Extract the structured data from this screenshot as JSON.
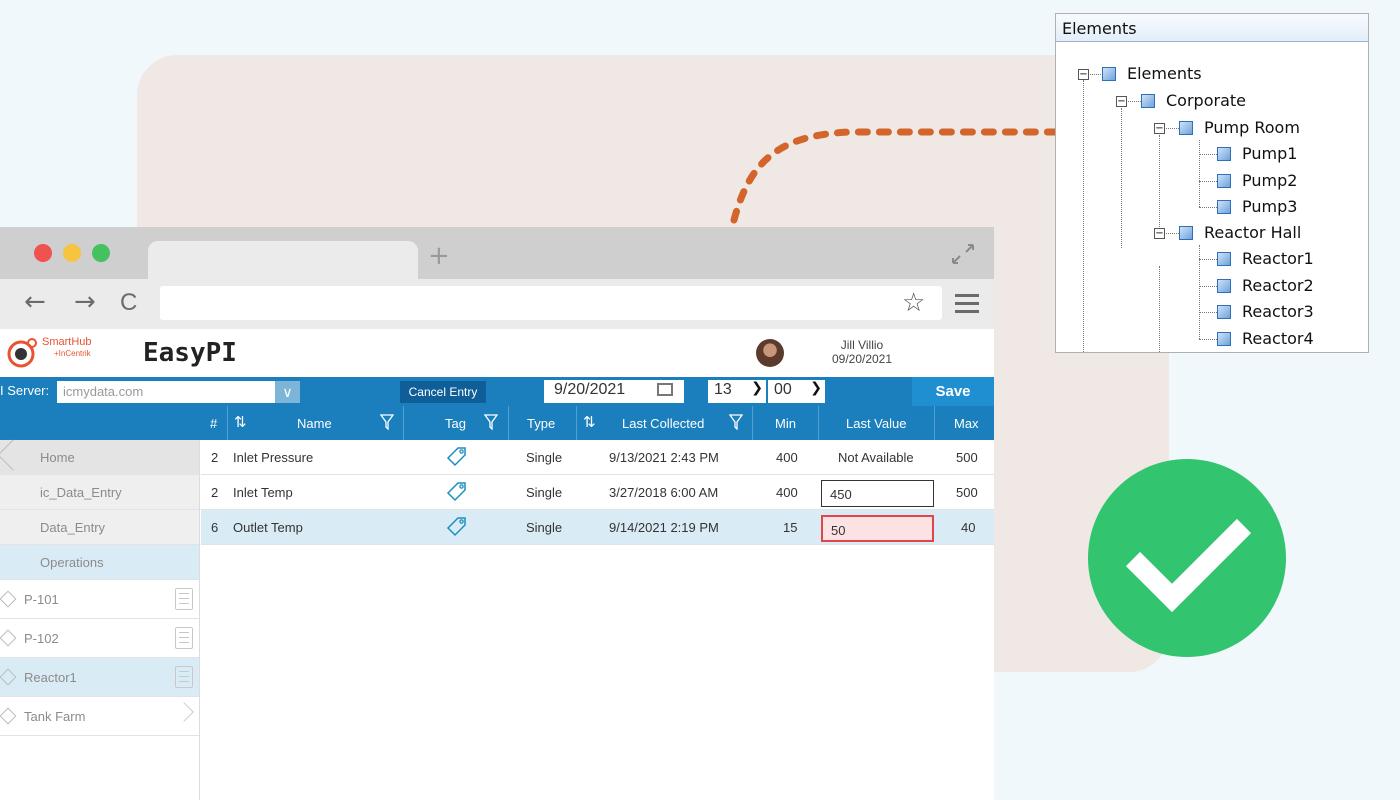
{
  "browser": {
    "new_tab_symbol": "+",
    "back_symbol": "←",
    "forward_symbol": "→",
    "reload_symbol": "C",
    "bookmark_symbol": "☆"
  },
  "app": {
    "logo_name": "SmartHub",
    "logo_sub": "+InCentrik",
    "title": "EasyPI",
    "user_name": "Jill Villio",
    "user_date": "09/20/2021"
  },
  "toolbar": {
    "server_label": "I Server:",
    "server_value": "icmydata.com",
    "cancel_label": "Cancel Entry",
    "date_value": "9/20/2021",
    "hour_value": "13",
    "minute_value": "00",
    "save_label": "Save"
  },
  "grid": {
    "columns": {
      "num": "#",
      "name": "Name",
      "tag": "Tag",
      "type": "Type",
      "last_collected": "Last Collected",
      "min": "Min",
      "last_value": "Last Value",
      "max": "Max"
    },
    "rows": [
      {
        "num": "2",
        "name": "Inlet Pressure",
        "type": "Single",
        "last_collected": "9/13/2021 2:43 PM",
        "min": "400",
        "last_value": "Not Available",
        "max": "500"
      },
      {
        "num": "2",
        "name": "Inlet Temp",
        "type": "Single",
        "last_collected": "3/27/2018 6:00 AM",
        "min": "400",
        "last_value": "450",
        "max": "500"
      },
      {
        "num": "6",
        "name": "Outlet Temp",
        "type": "Single",
        "last_collected": "9/14/2021 2:19 PM",
        "min": "15",
        "last_value": "50",
        "max": "40"
      }
    ]
  },
  "sidebar": {
    "nav": [
      "Home",
      "ic_Data_Entry",
      "Data_Entry",
      "Operations"
    ],
    "assets": [
      "P-101",
      "P-102",
      "Reactor1",
      "Tank Farm"
    ]
  },
  "elements_panel": {
    "header": "Elements",
    "root": "Elements",
    "corporate": "Corporate",
    "pump_room": "Pump Room",
    "pumps": [
      "Pump1",
      "Pump2",
      "Pump3"
    ],
    "reactor_hall": "Reactor Hall",
    "reactors": [
      "Reactor1",
      "Reactor2",
      "Reactor3",
      "Reactor4"
    ],
    "collapse_symbol": "−"
  },
  "colors": {
    "accent_blue": "#1a7fbc",
    "save_blue": "#1f8fd1",
    "error_red": "#e0454b",
    "check_green": "#33c46f",
    "connector_orange": "#d2642c"
  }
}
